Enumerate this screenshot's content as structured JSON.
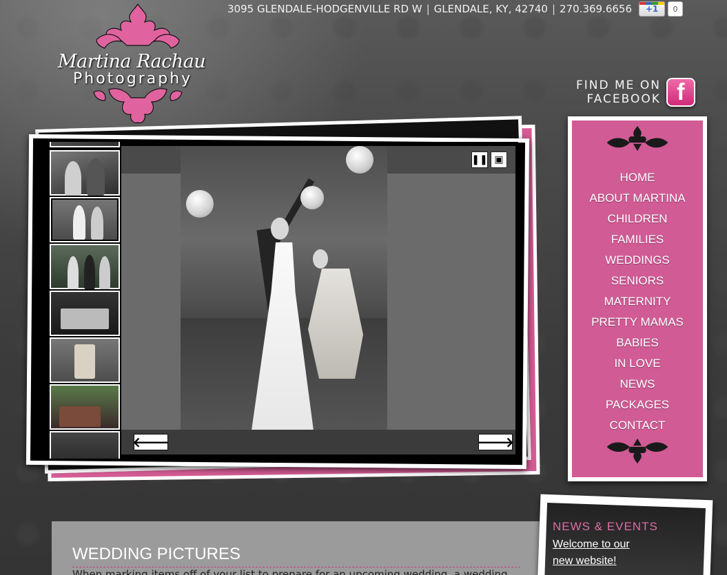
{
  "header": {
    "address": "3095 GLENDALE-HODGENVILLE RD W",
    "city": "GLENDALE, KY, 42740",
    "phone": "270.369.6656",
    "separator": "|",
    "gplus_label": "+1",
    "gplus_count": "0"
  },
  "logo": {
    "script": "Martina Rachau",
    "sub": "Photography"
  },
  "facebook": {
    "line1": "FIND ME ON",
    "line2": "FACEBOOK",
    "icon_letter": "f"
  },
  "slideshow": {
    "pause_icon": "pause-icon",
    "fullscreen_icon": "fullscreen-icon",
    "prev_icon": "arrow-left-icon",
    "next_icon": "arrow-right-icon",
    "thumbnail_count": 7,
    "selected_thumbnail": 2
  },
  "nav": {
    "items": [
      "HOME",
      "ABOUT MARTINA",
      "CHILDREN",
      "FAMILIES",
      "WEDDINGS",
      "SENIORS",
      "MATERNITY",
      "PRETTY MAMAS",
      "BABIES",
      "IN LOVE",
      "NEWS",
      "PACKAGES",
      "CONTACT"
    ]
  },
  "content": {
    "title": "WEDDING PICTURES",
    "intro": "When marking items off of your list to prepare for an upcoming wedding, a wedding"
  },
  "news": {
    "title": "NEWS & EVENTS",
    "link": "Welcome to our new website!"
  },
  "colors": {
    "accent_pink": "#d05b95",
    "background": "#3f3f3f"
  }
}
